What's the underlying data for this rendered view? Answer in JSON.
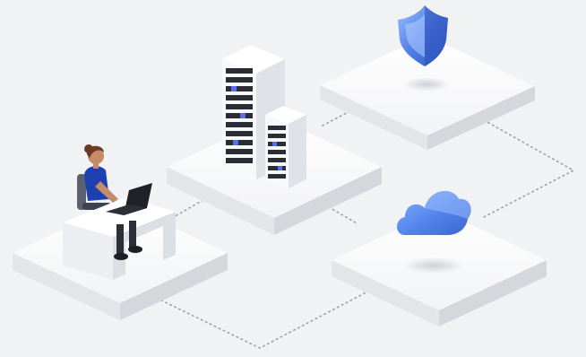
{
  "scene": {
    "nodes": [
      {
        "id": "workstation",
        "icon": "person-at-laptop-icon"
      },
      {
        "id": "data-center",
        "icon": "server-rack-icon"
      },
      {
        "id": "security",
        "icon": "shield-icon"
      },
      {
        "id": "cloud",
        "icon": "cloud-icon"
      }
    ],
    "connections": [
      {
        "from": "workstation",
        "to": "data-center",
        "style": "dotted"
      },
      {
        "from": "data-center",
        "to": "security",
        "style": "dotted"
      },
      {
        "from": "data-center",
        "to": "cloud",
        "style": "dotted"
      },
      {
        "from": "security",
        "to": "cloud",
        "style": "dotted"
      },
      {
        "from": "workstation",
        "to": "cloud",
        "style": "dotted"
      }
    ]
  },
  "colors": {
    "background": "#f1f2f4",
    "platform_top": "#fbfbfc",
    "platform_side_left": "#e3e5e9",
    "platform_side_right": "#d4d7dc",
    "connector": "#9aa0a8",
    "shield_blue": "#4a79e0",
    "cloud_blue": "#5a8ef0",
    "server_led": "#5a6df0",
    "shirt_blue": "#1e3fb0"
  }
}
